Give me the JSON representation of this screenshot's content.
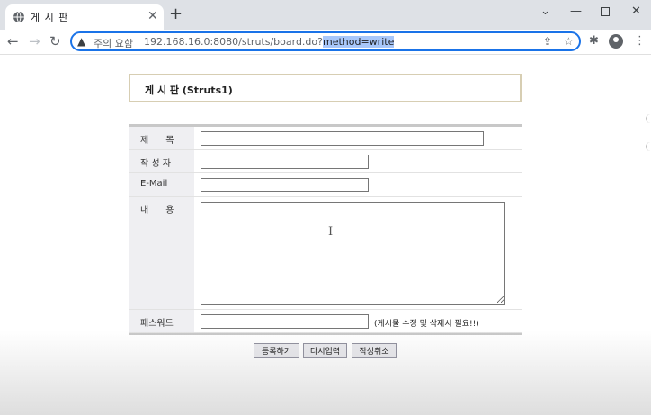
{
  "browser": {
    "tab_title": "게 시 판",
    "tab_close": "✕",
    "new_tab": "+",
    "security_label": "주의 요함",
    "url_main": "192.168.16.0:8080/struts/board.do?",
    "url_selected": "method=write"
  },
  "page": {
    "title": "게 시 판 (Struts1)"
  },
  "form": {
    "subject_label": "제      목",
    "author_label": "작 성 자",
    "email_label": "E-Mail",
    "content_label": "내      용",
    "password_label": "패스워드",
    "subject_value": "",
    "author_value": "",
    "email_value": "",
    "content_value": "",
    "password_value": "",
    "password_note": "(게시물 수정 및 삭제시 필요!!)"
  },
  "buttons": {
    "submit": "등록하기",
    "reset": "다시입력",
    "cancel": "작성취소"
  },
  "colors": {
    "accent": "#1a73e8",
    "title_border": "#d7ceb3",
    "label_bg": "#efeff2"
  }
}
